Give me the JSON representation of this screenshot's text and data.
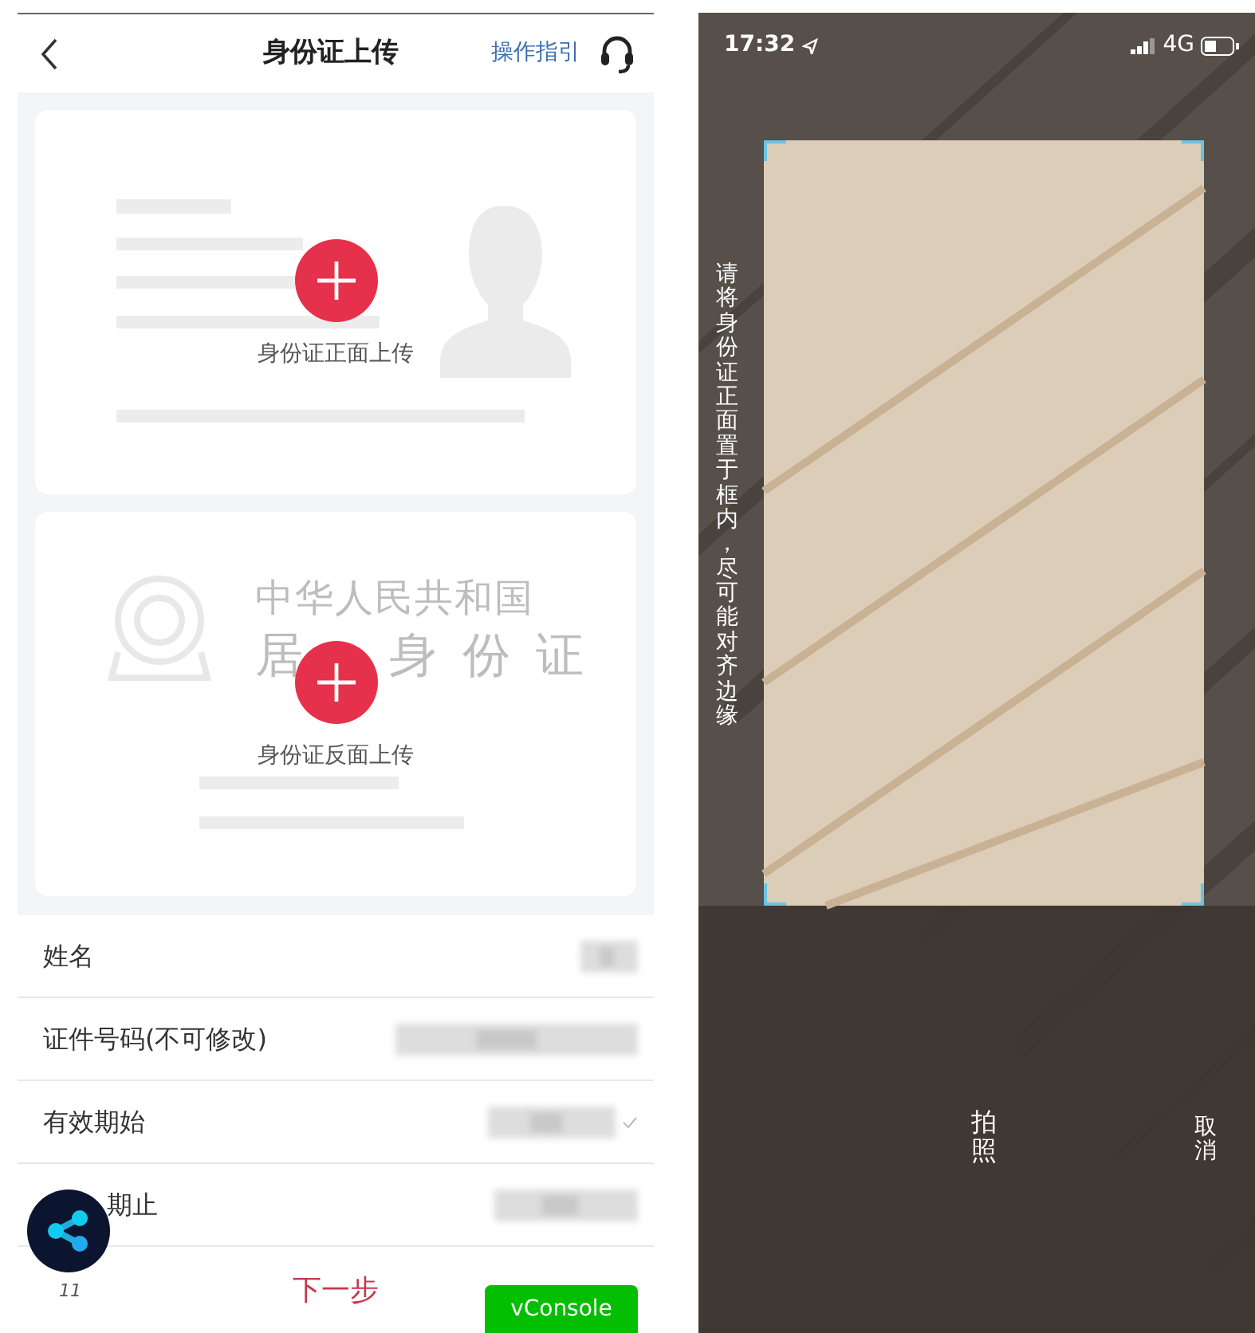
{
  "upload_screen": {
    "header": {
      "title": "身份证上传",
      "guide_link": "操作指引"
    },
    "upload_cards": [
      {
        "kind": "front",
        "label": "身份证正面上传"
      },
      {
        "kind": "back",
        "label": "身份证反面上传",
        "watermark_title": "中华人民共和国",
        "watermark_words": [
          "居",
          "身份证"
        ]
      }
    ],
    "fields": [
      {
        "label": "姓名",
        "has_tick": false,
        "covered": false
      },
      {
        "label": "证件号码(不可修改)",
        "has_tick": false,
        "covered": false
      },
      {
        "label": "有效期始",
        "has_tick": true,
        "covered": false
      },
      {
        "label": "期止",
        "has_tick": false,
        "covered": true
      }
    ],
    "floating_badge": "11",
    "next_button": "下一步",
    "console_button": "vConsole"
  },
  "camera_screen": {
    "status_bar": {
      "time": "17:32",
      "network": "4G"
    },
    "hint": "请将身份证正面置于框内，尽可能对齐边缘",
    "shutter": "拍照",
    "cancel": "取消"
  }
}
